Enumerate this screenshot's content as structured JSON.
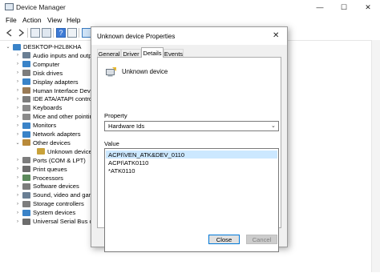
{
  "window": {
    "title": "Device Manager",
    "controls": {
      "minimize": "—",
      "maximize": "☐",
      "close": "✕"
    }
  },
  "menu": [
    "File",
    "Action",
    "View",
    "Help"
  ],
  "tree": {
    "root": "DESKTOP-H2L8KHA",
    "items": [
      {
        "label": "Audio inputs and outputs",
        "icon": "speaker-icon",
        "color": "#6a7f94"
      },
      {
        "label": "Computer",
        "icon": "computer-icon",
        "color": "#3a83c8"
      },
      {
        "label": "Disk drives",
        "icon": "disk-icon",
        "color": "#7d7d7d"
      },
      {
        "label": "Display adapters",
        "icon": "display-icon",
        "color": "#3a83c8"
      },
      {
        "label": "Human Interface Devices",
        "icon": "hid-icon",
        "color": "#9a7b56"
      },
      {
        "label": "IDE ATA/ATAPI controllers",
        "icon": "ide-icon",
        "color": "#7d7d7d"
      },
      {
        "label": "Keyboards",
        "icon": "keyboard-icon",
        "color": "#8a8a8a"
      },
      {
        "label": "Mice and other pointing devices",
        "icon": "mouse-icon",
        "color": "#8a8a8a"
      },
      {
        "label": "Monitors",
        "icon": "monitor-icon",
        "color": "#3a83c8"
      },
      {
        "label": "Network adapters",
        "icon": "network-icon",
        "color": "#3a83c8"
      },
      {
        "label": "Other devices",
        "icon": "other-devices-icon",
        "color": "#b98a3a",
        "expanded": true
      },
      {
        "label": "Unknown device",
        "icon": "unknown-device-icon",
        "color": "#c9a23a",
        "child": true
      },
      {
        "label": "Ports (COM & LPT)",
        "icon": "port-icon",
        "color": "#7d7d7d"
      },
      {
        "label": "Print queues",
        "icon": "printer-icon",
        "color": "#6d6d6d"
      },
      {
        "label": "Processors",
        "icon": "processor-icon",
        "color": "#5c8a5c"
      },
      {
        "label": "Software devices",
        "icon": "software-device-icon",
        "color": "#7d7d7d"
      },
      {
        "label": "Sound, video and game controllers",
        "icon": "sound-icon",
        "color": "#6a7f94"
      },
      {
        "label": "Storage controllers",
        "icon": "storage-icon",
        "color": "#7d7d7d"
      },
      {
        "label": "System devices",
        "icon": "system-icon",
        "color": "#3a83c8"
      },
      {
        "label": "Universal Serial Bus controllers",
        "icon": "usb-icon",
        "color": "#6d6d6d"
      }
    ]
  },
  "dialog": {
    "title": "Unknown device Properties",
    "tabs": [
      "General",
      "Driver",
      "Details",
      "Events"
    ],
    "active_tab": "Details",
    "device_name": "Unknown device",
    "property_label": "Property",
    "property_value": "Hardware Ids",
    "value_label": "Value",
    "values": [
      "ACPI\\VEN_ATK&DEV_0110",
      "ACPI\\ATK0110",
      "*ATK0110"
    ],
    "close_label": "Close",
    "cancel_label": "Cancel"
  },
  "colors": {
    "accent": "#0078d7",
    "selection": "#cce8ff"
  }
}
